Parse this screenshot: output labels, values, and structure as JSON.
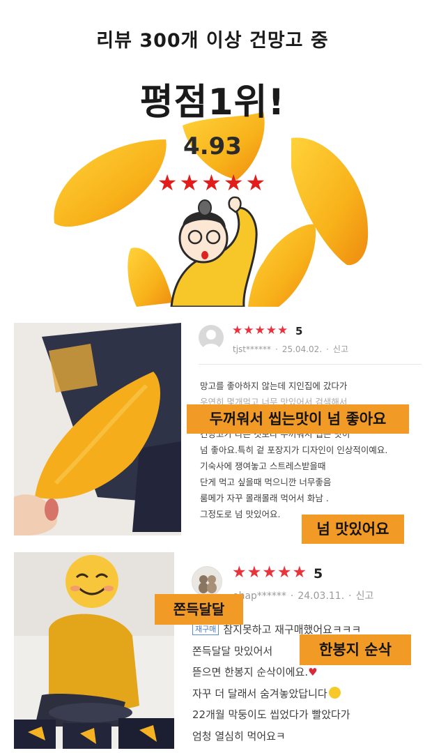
{
  "hero": {
    "headline1": "리뷰 300개 이상 건망고 중",
    "headline2": "평점1위!",
    "rating": "4.93",
    "stars": "★★★★★"
  },
  "reviews": [
    {
      "stars": "★★★★★",
      "score": "5",
      "username": "tjst******",
      "date": "25.04.02.",
      "report_label": "신고",
      "lines": [
        "망고를 좋아하지 않는데 지인집에 갔다가",
        "우연히 몇개먹고 너무 맛있어서 검색해서",
        "건망고가 다른 것보다 두꺼워서 씹는 맛이",
        "넘 좋아요.특히 겉 포장지가 디자인이 인상적이예요.",
        "기숙사에 쟁여놓고 스트레스받을때",
        "단게 먹고 싶을때 먹으니깐 너무좋음",
        "룸메가 자꾸 몰래몰래 먹어서 화남 .",
        "그정도로 넘 맛있어요."
      ],
      "callouts": [
        "두꺼워서 씹는맛이 넘 좋아요",
        "넘 맛있어요"
      ]
    },
    {
      "stars": "★★★★★",
      "score": "5",
      "username": "ohap******",
      "date": "24.03.11.",
      "report_label": "신고",
      "badge": "재구매",
      "lines": [
        "참지못하고 재구매했어요ㅋㅋㅋ",
        "쫀득달달 맛있어서",
        "뜯으면 한봉지 순삭이에요.",
        "자꾸 더 달래서 숨겨놓았답니다",
        "22개월 막둥이도 씹었다가 빨았다가",
        "엄청 열심히 먹어요ㅋ"
      ],
      "callouts": [
        "쫀득달달",
        "한봉지 순삭"
      ]
    }
  ],
  "colors": {
    "star_red": "#e21b1b",
    "callout_orange": "#f29a26",
    "mango_yellow": "#f8b81a"
  }
}
